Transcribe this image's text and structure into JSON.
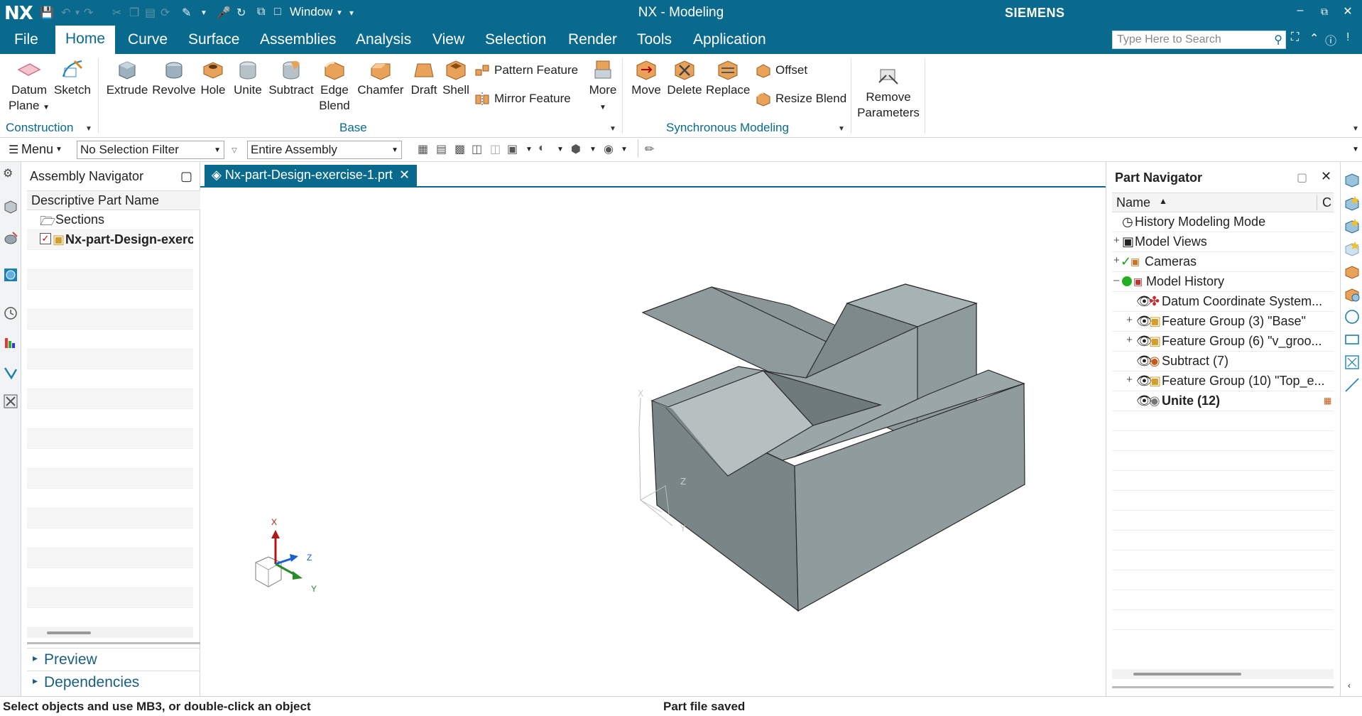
{
  "titlebar": {
    "logo": "NX",
    "window_label": "Window",
    "app_title": "NX - Modeling",
    "brand": "SIEMENS"
  },
  "tabs": [
    "File",
    "Home",
    "Curve",
    "Surface",
    "Assemblies",
    "Analysis",
    "View",
    "Selection",
    "Render",
    "Tools",
    "Application"
  ],
  "search": {
    "placeholder": "Type Here to Search"
  },
  "ribbon": {
    "datum_plane": "Datum\nPlane",
    "datum_plane_1": "Datum",
    "datum_plane_2": "Plane",
    "sketch": "Sketch",
    "construction": "Construction",
    "extrude": "Extrude",
    "revolve": "Revolve",
    "hole": "Hole",
    "unite": "Unite",
    "subtract": "Subtract",
    "edge_blend_1": "Edge",
    "edge_blend_2": "Blend",
    "chamfer": "Chamfer",
    "draft": "Draft",
    "shell": "Shell",
    "pattern_feature": "Pattern Feature",
    "mirror_feature": "Mirror Feature",
    "more": "More",
    "base": "Base",
    "move": "Move",
    "delete": "Delete",
    "replace": "Replace",
    "offset": "Offset",
    "resize_blend": "Resize Blend",
    "synchronous_modeling": "Synchronous Modeling",
    "remove_parameters_1": "Remove",
    "remove_parameters_2": "Parameters"
  },
  "toolbar": {
    "menu": "Menu",
    "selection_filter": "No Selection Filter",
    "scope": "Entire Assembly"
  },
  "assembly_nav": {
    "title": "Assembly Navigator",
    "column": "Descriptive Part Name",
    "sections": "Sections",
    "part": "Nx-part-Design-exerc",
    "preview": "Preview",
    "dependencies": "Dependencies"
  },
  "document_tab": "Nx-part-Design-exercise-1.prt",
  "triad": {
    "x": "X",
    "y": "Y",
    "z": "Z"
  },
  "part_nav": {
    "title": "Part Navigator",
    "column_name": "Name",
    "column_c": "C",
    "rows": [
      "History Modeling Mode",
      "Model Views",
      "Cameras",
      "Model History",
      "Datum Coordinate System...",
      "Feature Group (3) \"Base\"",
      "Feature Group (6) \"v_groo...",
      "Subtract (7)",
      "Feature Group (10) \"Top_e...",
      "Unite (12)"
    ]
  },
  "status": {
    "left": "Select objects and use MB3, or double-click an object",
    "center": "Part file saved"
  }
}
